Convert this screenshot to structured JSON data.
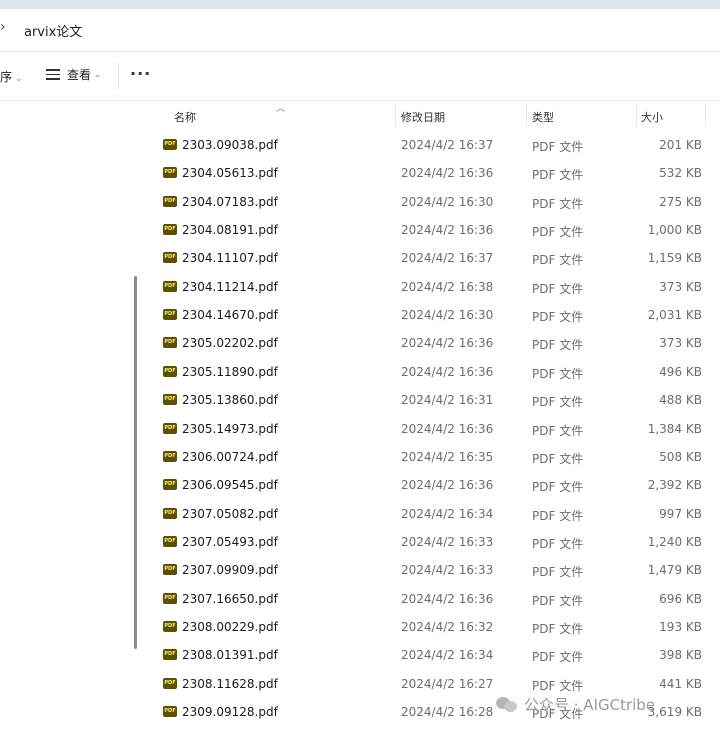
{
  "address": {
    "chevron": "›",
    "path": "arvix论文"
  },
  "toolbar": {
    "sort_label": "序",
    "view_label": "查看",
    "more_label": "···"
  },
  "columns": {
    "name": "名称",
    "date": "修改日期",
    "type": "类型",
    "size": "大小"
  },
  "files": [
    {
      "name": "2303.09038.pdf",
      "date": "2024/4/2 16:37",
      "type": "PDF 文件",
      "size": "201 KB"
    },
    {
      "name": "2304.05613.pdf",
      "date": "2024/4/2 16:36",
      "type": "PDF 文件",
      "size": "532 KB"
    },
    {
      "name": "2304.07183.pdf",
      "date": "2024/4/2 16:30",
      "type": "PDF 文件",
      "size": "275 KB"
    },
    {
      "name": "2304.08191.pdf",
      "date": "2024/4/2 16:36",
      "type": "PDF 文件",
      "size": "1,000 KB"
    },
    {
      "name": "2304.11107.pdf",
      "date": "2024/4/2 16:37",
      "type": "PDF 文件",
      "size": "1,159 KB"
    },
    {
      "name": "2304.11214.pdf",
      "date": "2024/4/2 16:38",
      "type": "PDF 文件",
      "size": "373 KB"
    },
    {
      "name": "2304.14670.pdf",
      "date": "2024/4/2 16:30",
      "type": "PDF 文件",
      "size": "2,031 KB"
    },
    {
      "name": "2305.02202.pdf",
      "date": "2024/4/2 16:36",
      "type": "PDF 文件",
      "size": "373 KB"
    },
    {
      "name": "2305.11890.pdf",
      "date": "2024/4/2 16:36",
      "type": "PDF 文件",
      "size": "496 KB"
    },
    {
      "name": "2305.13860.pdf",
      "date": "2024/4/2 16:31",
      "type": "PDF 文件",
      "size": "488 KB"
    },
    {
      "name": "2305.14973.pdf",
      "date": "2024/4/2 16:36",
      "type": "PDF 文件",
      "size": "1,384 KB"
    },
    {
      "name": "2306.00724.pdf",
      "date": "2024/4/2 16:35",
      "type": "PDF 文件",
      "size": "508 KB"
    },
    {
      "name": "2306.09545.pdf",
      "date": "2024/4/2 16:36",
      "type": "PDF 文件",
      "size": "2,392 KB"
    },
    {
      "name": "2307.05082.pdf",
      "date": "2024/4/2 16:34",
      "type": "PDF 文件",
      "size": "997 KB"
    },
    {
      "name": "2307.05493.pdf",
      "date": "2024/4/2 16:33",
      "type": "PDF 文件",
      "size": "1,240 KB"
    },
    {
      "name": "2307.09909.pdf",
      "date": "2024/4/2 16:33",
      "type": "PDF 文件",
      "size": "1,479 KB"
    },
    {
      "name": "2307.16650.pdf",
      "date": "2024/4/2 16:36",
      "type": "PDF 文件",
      "size": "696 KB"
    },
    {
      "name": "2308.00229.pdf",
      "date": "2024/4/2 16:32",
      "type": "PDF 文件",
      "size": "193 KB"
    },
    {
      "name": "2308.01391.pdf",
      "date": "2024/4/2 16:34",
      "type": "PDF 文件",
      "size": "398 KB"
    },
    {
      "name": "2308.11628.pdf",
      "date": "2024/4/2 16:27",
      "type": "PDF 文件",
      "size": "441 KB"
    },
    {
      "name": "2309.09128.pdf",
      "date": "2024/4/2 16:28",
      "type": "PDF 文件",
      "size": "3,619 KB"
    }
  ],
  "icons": {
    "pdf": "pdf-file-icon",
    "pdf_badge": "PDF"
  },
  "watermark": {
    "text": "公众号 · AIGCtribe"
  },
  "colors": {
    "pdf_icon_bg": "#5b5100",
    "pdf_icon_fg": "#f7e87a",
    "secondary_text": "#6d6d6d"
  }
}
